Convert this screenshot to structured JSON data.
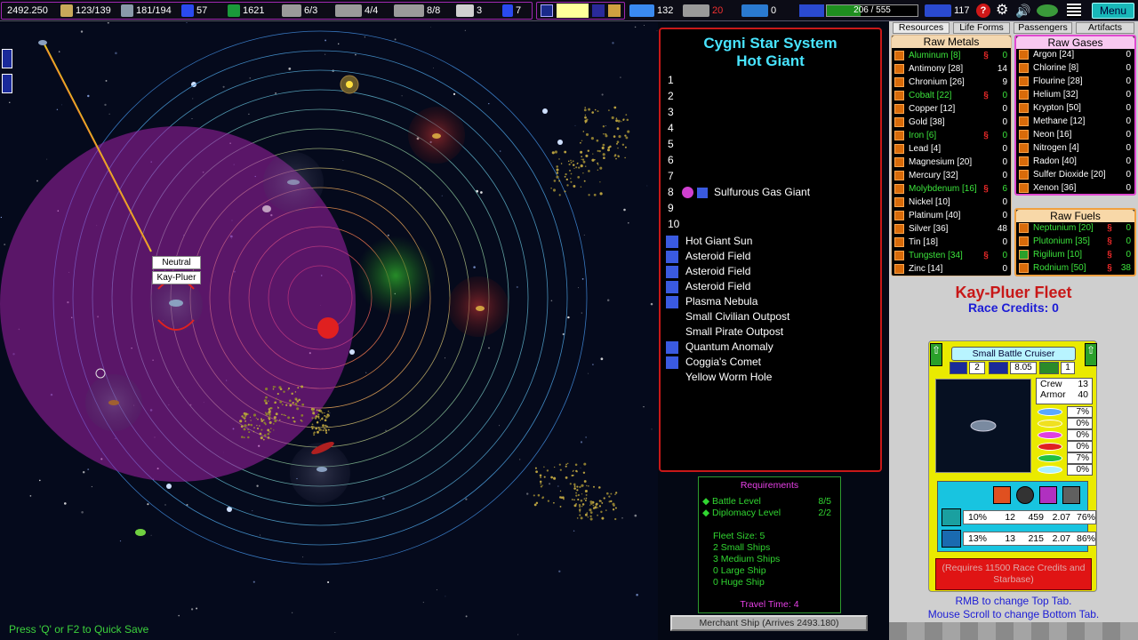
{
  "topbar": {
    "date": "2492.250",
    "stat1": "123/139",
    "stat2": "181/194",
    "stat3": "57",
    "credits": "1621",
    "ships": "6/3",
    "stat6": "4/4",
    "stat7": "8/8",
    "stat8": "3",
    "stat9": "7",
    "medical": "132",
    "red_count": "20",
    "stat12": "0",
    "xp": "206 / 555",
    "xp_fraction": 0.371,
    "stat14": "117",
    "menu_label": "Menu",
    "icons": [
      "flag-icon",
      "cargo-icon",
      "ship-icon",
      "fuel-icon",
      "dollar-icon",
      "fighter-icon",
      "freighter-icon",
      "battleship-icon",
      "crew-icon",
      "scientist-icon",
      "map-icon",
      "handshake-icon",
      "medical-icon",
      "satellite-icon",
      "shield-icon",
      "drive-icon",
      "help-icon",
      "gear-icon",
      "sound-icon",
      "alien-icon",
      "list-icon"
    ]
  },
  "map": {
    "labels": {
      "neutral": "Neutral",
      "race": "Kay-Pluer"
    },
    "quicksave": "Press 'Q' or F2 to Quick Save"
  },
  "system": {
    "title": "Cygni Star System",
    "subtitle": "Hot Giant",
    "orbits": [
      {
        "num": "1",
        "name": ""
      },
      {
        "num": "2",
        "name": ""
      },
      {
        "num": "3",
        "name": ""
      },
      {
        "num": "4",
        "name": ""
      },
      {
        "num": "5",
        "name": ""
      },
      {
        "num": "6",
        "name": ""
      },
      {
        "num": "7",
        "name": ""
      },
      {
        "num": "8",
        "name": "Sulfurous Gas Giant"
      },
      {
        "num": "9",
        "name": ""
      },
      {
        "num": "10",
        "name": ""
      }
    ],
    "features": [
      {
        "name": "Hot Giant Sun",
        "icon": true
      },
      {
        "name": "Asteroid Field",
        "icon": true
      },
      {
        "name": "Asteroid Field",
        "icon": true
      },
      {
        "name": "Asteroid Field",
        "icon": true
      },
      {
        "name": "Plasma Nebula",
        "icon": true
      },
      {
        "name": "Small Civilian Outpost",
        "icon": false
      },
      {
        "name": "Small Pirate Outpost",
        "icon": false
      },
      {
        "name": "Quantum Anomaly",
        "icon": true
      },
      {
        "name": "Coggia's Comet",
        "icon": true
      },
      {
        "name": "Yellow Worm Hole",
        "icon": false
      }
    ]
  },
  "requirements": {
    "title": "Requirements",
    "rows": [
      {
        "label": "Battle Level",
        "value": "8/5"
      },
      {
        "label": "Diplomacy Level",
        "value": "2/2"
      }
    ],
    "fleet_size": "Fleet Size: 5",
    "sizes": [
      "2  Small Ships",
      "3  Medium Ships",
      "0  Large Ship",
      "0  Huge Ship"
    ],
    "travel_time": "Travel Time: 4"
  },
  "merchant": "Merchant Ship (Arrives 2493.180)",
  "tabs": [
    "Resources",
    "Life Forms",
    "Passengers",
    "Artifacts"
  ],
  "raw_metals": {
    "title": "Raw Metals",
    "items": [
      {
        "name": "Aluminum [8]",
        "value": "0",
        "green": true,
        "link": true
      },
      {
        "name": "Antimony [28]",
        "value": "14",
        "green": false,
        "link": false
      },
      {
        "name": "Chronium [26]",
        "value": "9",
        "green": false,
        "link": false
      },
      {
        "name": "Cobalt [22]",
        "value": "0",
        "green": true,
        "link": true
      },
      {
        "name": "Copper [12]",
        "value": "0",
        "green": false,
        "link": false
      },
      {
        "name": "Gold [38]",
        "value": "0",
        "green": false,
        "link": false
      },
      {
        "name": "Iron [6]",
        "value": "0",
        "green": true,
        "link": true
      },
      {
        "name": "Lead [4]",
        "value": "0",
        "green": false,
        "link": false
      },
      {
        "name": "Magnesium [20]",
        "value": "0",
        "green": false,
        "link": false
      },
      {
        "name": "Mercury [32]",
        "value": "0",
        "green": false,
        "link": false
      },
      {
        "name": "Molybdenum [16]",
        "value": "6",
        "green": true,
        "link": true
      },
      {
        "name": "Nickel [10]",
        "value": "0",
        "green": false,
        "link": false
      },
      {
        "name": "Platinum [40]",
        "value": "0",
        "green": false,
        "link": false
      },
      {
        "name": "Silver [36]",
        "value": "48",
        "green": false,
        "link": false
      },
      {
        "name": "Tin [18]",
        "value": "0",
        "green": false,
        "link": false
      },
      {
        "name": "Tungsten [34]",
        "value": "0",
        "green": true,
        "link": true
      },
      {
        "name": "Zinc [14]",
        "value": "0",
        "green": false,
        "link": false
      }
    ]
  },
  "raw_gases": {
    "title": "Raw Gases",
    "items": [
      {
        "name": "Argon [24]",
        "value": "0"
      },
      {
        "name": "Chlorine [8]",
        "value": "0"
      },
      {
        "name": "Flourine [28]",
        "value": "0"
      },
      {
        "name": "Helium [32]",
        "value": "0"
      },
      {
        "name": "Krypton [50]",
        "value": "0"
      },
      {
        "name": "Methane [12]",
        "value": "0"
      },
      {
        "name": "Neon [16]",
        "value": "0"
      },
      {
        "name": "Nitrogen [4]",
        "value": "0"
      },
      {
        "name": "Radon [40]",
        "value": "0"
      },
      {
        "name": "Sulfer Dioxide [20]",
        "value": "0"
      },
      {
        "name": "Xenon [36]",
        "value": "0"
      }
    ]
  },
  "raw_fuels": {
    "title": "Raw Fuels",
    "items": [
      {
        "name": "Neptunium [20]",
        "value": "0",
        "link": true
      },
      {
        "name": "Plutonium [35]",
        "value": "0",
        "link": true
      },
      {
        "name": "Rigilium [10]",
        "value": "0",
        "link": true
      },
      {
        "name": "Rodnium [50]",
        "value": "38",
        "link": true
      }
    ]
  },
  "fleet": {
    "title": "Kay-Pluer Fleet",
    "credits": "Race Credits: 0",
    "ship_name": "Small Battle Cruiser",
    "stats": [
      "2",
      "8.05",
      "1"
    ],
    "crew_label": "Crew",
    "crew": "13",
    "armor_label": "Armor",
    "armor": "40",
    "resist": [
      {
        "color": "#5aa8ff",
        "value": "7%"
      },
      {
        "color": "#f0e020",
        "value": "0%"
      },
      {
        "color": "#e040e0",
        "value": "0%"
      },
      {
        "color": "#e02020",
        "value": "0%"
      },
      {
        "color": "#20c040",
        "value": "7%"
      },
      {
        "color": "#a8f0ff",
        "value": "0%"
      }
    ],
    "weapons": [
      [
        "10%",
        "12",
        "459",
        "2.07",
        "76%"
      ],
      [
        "13%",
        "13",
        "215",
        "2.07",
        "86%"
      ]
    ],
    "requires": "(Requires 11500 Race Credits and Starbase)",
    "hint1": "RMB to change Top Tab.",
    "hint2": "Mouse Scroll to change Bottom Tab."
  }
}
